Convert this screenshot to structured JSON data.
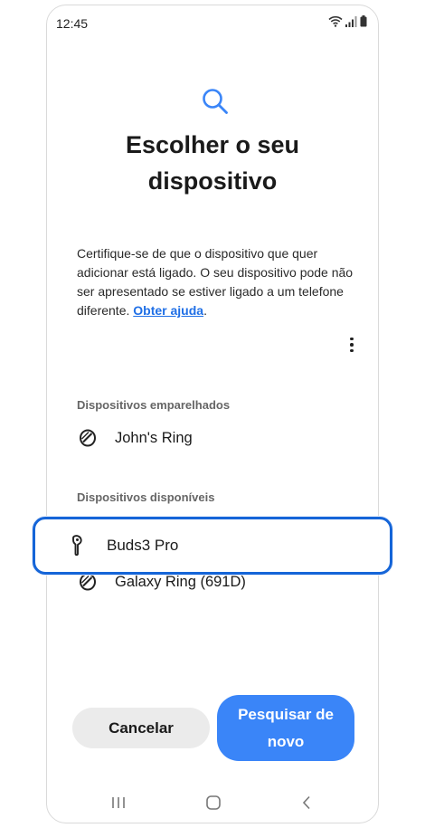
{
  "status": {
    "time": "12:45"
  },
  "header": {
    "title_line1": "Escolher o seu",
    "title_line2": "dispositivo"
  },
  "description": {
    "text": "Certifique-se de que o dispositivo que quer adicionar está ligado. O seu dispositivo pode não ser apresentado se estiver ligado a um telefone diferente. ",
    "link": "Obter ajuda",
    "end": "."
  },
  "paired": {
    "label": "Dispositivos emparelhados",
    "items": [
      {
        "name": "John's Ring",
        "icon": "ring-icon"
      }
    ]
  },
  "available": {
    "label": "Dispositivos disponíveis",
    "items": [
      {
        "name": "Buds3 Pro",
        "icon": "earbud-icon",
        "highlighted": true
      },
      {
        "name": "Galaxy Ring (691D)",
        "icon": "ring-icon"
      }
    ]
  },
  "buttons": {
    "cancel": "Cancelar",
    "search_again": "Pesquisar de novo"
  },
  "colors": {
    "accent": "#3a85f8",
    "highlight_border": "#1565d8",
    "link": "#1f6fe6"
  }
}
